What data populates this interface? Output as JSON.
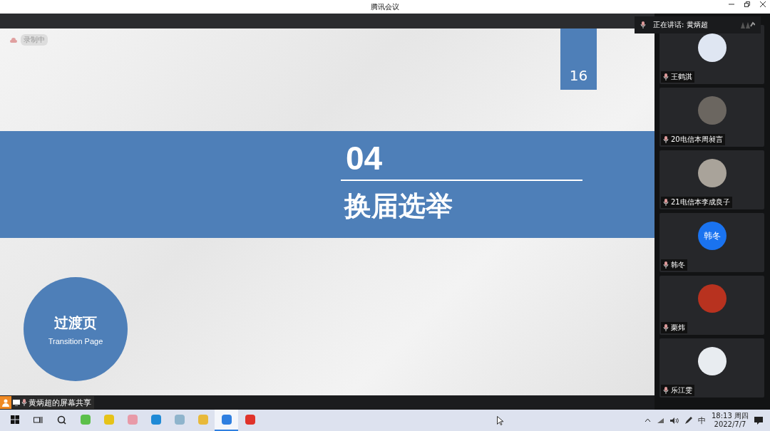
{
  "window": {
    "title": "腾讯会议"
  },
  "recording": {
    "label": "录制中"
  },
  "slide": {
    "page_number": "16",
    "section_number": "04",
    "section_title": "换届选举",
    "badge_title": "过渡页",
    "badge_subtitle": "Transition Page"
  },
  "speaking": {
    "label": "正在讲话: 黄炳超"
  },
  "participants": [
    {
      "name": "王鹤淇",
      "kind": "photo",
      "color": "#dfe6f2"
    },
    {
      "name": "20电信本周昶言",
      "kind": "photo",
      "color": "#6b6660"
    },
    {
      "name": "21电信本李成良子",
      "kind": "photo",
      "color": "#a9a39a"
    },
    {
      "name": "韩冬",
      "kind": "initials",
      "initials": "韩冬",
      "color": "#1a73f0"
    },
    {
      "name": "栗炜",
      "kind": "photo",
      "color": "#b8321f"
    },
    {
      "name": "乐江雯",
      "kind": "photo",
      "color": "#e8ecf0"
    }
  ],
  "share_bar": {
    "label": "黄炳超的屏幕共享"
  },
  "taskbar": {
    "apps": [
      {
        "kind": "windows",
        "selected": false
      },
      {
        "kind": "taskview",
        "selected": false
      },
      {
        "kind": "search",
        "selected": false
      },
      {
        "kind": "app",
        "color": "#5cc04a",
        "selected": false
      },
      {
        "kind": "app",
        "color": "#e6c319",
        "selected": false
      },
      {
        "kind": "app",
        "color": "#e89aa8",
        "selected": false
      },
      {
        "kind": "app",
        "color": "#1f8ad6",
        "selected": false
      },
      {
        "kind": "app",
        "color": "#8fb4cc",
        "selected": false
      },
      {
        "kind": "app",
        "color": "#e8b93a",
        "selected": false
      },
      {
        "kind": "app",
        "color": "#2f7fe0",
        "selected": true
      },
      {
        "kind": "app",
        "color": "#e0332b",
        "selected": false
      }
    ],
    "ime": "中",
    "time": "18:13 周四",
    "date": "2022/7/7"
  }
}
